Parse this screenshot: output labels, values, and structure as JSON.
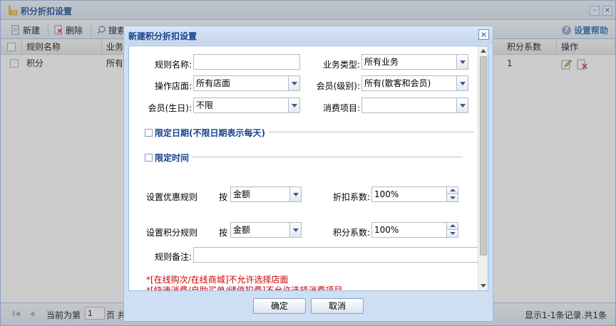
{
  "panel": {
    "title": "积分折扣设置",
    "toolbar": {
      "new_label": "新建",
      "delete_label": "删除",
      "search_label": "搜索",
      "help_label": "设置帮助"
    },
    "grid": {
      "columns": [
        "规则名称",
        "业务",
        "积分系数",
        "操作"
      ],
      "rows": [
        {
          "rule_name": "积分",
          "business": "所有",
          "coefficient": "1"
        }
      ]
    },
    "pager": {
      "current_label": "当前为第",
      "page_value": "1",
      "page_suffix": "页 共",
      "summary": "显示1-1条记录.共1条"
    }
  },
  "dialog": {
    "title": "新建积分折扣设置",
    "rule_name_label": "规则名称:",
    "rule_name_value": "",
    "business_type_label": "业务类型:",
    "business_type_value": "所有业务",
    "store_label": "操作店面:",
    "store_value": "所有店面",
    "member_level_label": "会员(级别):",
    "member_level_value": "所有(散客和会员)",
    "member_birthday_label": "会员(生日):",
    "member_birthday_value": "不限",
    "consume_item_label": "消费项目:",
    "consume_item_value": "",
    "limit_date_label": "限定日期(不限日期表示每天)",
    "limit_time_label": "限定时间",
    "discount_rule_label": "设置优惠规则",
    "discount_by_label": "按",
    "discount_by_value": "金额",
    "discount_coef_label": "折扣系数:",
    "discount_coef_value": "100%",
    "points_rule_label": "设置积分规则",
    "points_by_label": "按",
    "points_by_value": "金额",
    "points_coef_label": "积分系数:",
    "points_coef_value": "100%",
    "remark_label": "规则备注:",
    "remark_value": "",
    "notes": [
      "*[在线购次/在线商城]不允许选择店面",
      "*[快速消费/自助买单/储值扣费]不允许选择消费项目"
    ],
    "ok_label": "确定",
    "cancel_label": "取消"
  },
  "colors": {
    "header_text": "#15428b",
    "accent": "#99bbe8",
    "note_red": "#cc0000"
  }
}
